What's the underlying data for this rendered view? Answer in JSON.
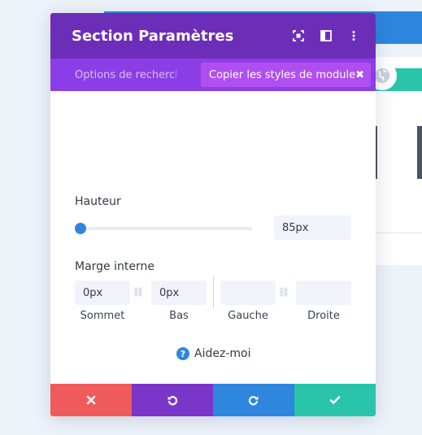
{
  "modal": {
    "title": "Section Paramètres",
    "tabs": {
      "search_label": "Options de recherche",
      "copy_styles_label": "Copier les styles de module",
      "copy_close_icon": "✖"
    },
    "height": {
      "label": "Hauteur",
      "value": "85px",
      "slider_fraction": 0.0
    },
    "padding": {
      "label": "Marge interne",
      "top_value": "0px",
      "bottom_value": "0px",
      "left_value": "",
      "right_value": "",
      "top_label": "Sommet",
      "bottom_label": "Bas",
      "left_label": "Gauche",
      "right_label": "Droite"
    },
    "help_label": "Aidez-moi",
    "help_icon": "?"
  },
  "colors": {
    "header": "#6c2eb9",
    "tabbar": "#8c3ee6",
    "chip": "#b04ff0",
    "cancel": "#ef5a5a",
    "undo": "#7a36c8",
    "redo": "#2e86de",
    "save": "#29c4a9"
  },
  "icons": {
    "header": [
      "focus-icon",
      "split-view-icon",
      "more-vertical-icon"
    ],
    "footer": [
      "close-icon",
      "undo-icon",
      "redo-icon",
      "check-icon"
    ]
  }
}
